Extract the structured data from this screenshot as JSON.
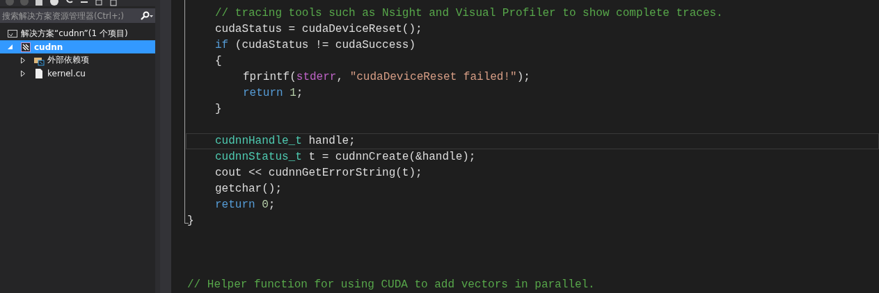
{
  "solution_explorer": {
    "search": {
      "placeholder": "搜索解决方案资源管理器(Ctrl+;)"
    },
    "tree": [
      {
        "label": "解决方案“cudnn”(1 个项目)",
        "kind": "solution",
        "selected": false,
        "children": [
          {
            "label": "cudnn",
            "kind": "project",
            "selected": true,
            "expanded": true,
            "children": [
              {
                "label": "外部依赖项",
                "kind": "references",
                "selected": false,
                "expanded": false
              },
              {
                "label": "kernel.cu",
                "kind": "file",
                "selected": false,
                "expanded": false
              }
            ]
          }
        ]
      }
    ]
  },
  "editor": {
    "lines": [
      {
        "children": [
          {
            "current": false,
            "tokens": [
              {
                "kind": "comment",
                "text": "// tracing tools such as Nsight and Visual Profiler to show complete traces."
              }
            ]
          },
          {
            "current": false,
            "tokens": [
              {
                "kind": "plain",
                "text": "cudaStatus = cudaDeviceReset();"
              }
            ]
          },
          {
            "current": false,
            "tokens": [
              {
                "kind": "keyword",
                "text": "if"
              },
              {
                "kind": "plain",
                "text": " (cudaStatus != cudaSuccess)"
              }
            ]
          },
          {
            "current": false,
            "tokens": [
              {
                "kind": "plain",
                "text": "{"
              }
            ]
          },
          {
            "children": [
              {
                "current": false,
                "tokens": [
                  {
                    "kind": "plain",
                    "text": "fprintf("
                  },
                  {
                    "kind": "macro",
                    "text": "stderr"
                  },
                  {
                    "kind": "plain",
                    "text": ", "
                  },
                  {
                    "kind": "string",
                    "text": "\"cudaDeviceReset failed!\""
                  },
                  {
                    "kind": "plain",
                    "text": ");"
                  }
                ]
              },
              {
                "current": false,
                "tokens": [
                  {
                    "kind": "keyword",
                    "text": "return"
                  },
                  {
                    "kind": "number",
                    "text": " 1"
                  },
                  {
                    "kind": "plain",
                    "text": ";"
                  }
                ]
              }
            ]
          },
          {
            "current": false,
            "tokens": [
              {
                "kind": "plain",
                "text": "}"
              }
            ]
          },
          {
            "current": false
          },
          {
            "current": true,
            "tokens": [
              {
                "kind": "type",
                "text": "cudnnHandle_t"
              },
              {
                "kind": "plain",
                "text": " handle;"
              }
            ]
          },
          {
            "current": false,
            "tokens": [
              {
                "kind": "type",
                "text": "cudnnStatus_t"
              },
              {
                "kind": "plain",
                "text": " t = cudnnCreate(&handle);"
              }
            ]
          },
          {
            "current": false,
            "tokens": [
              {
                "kind": "plain",
                "text": "cout << cudnnGetErrorString(t);"
              }
            ]
          },
          {
            "current": false,
            "tokens": [
              {
                "kind": "plain",
                "text": "getchar();"
              }
            ]
          },
          {
            "current": false,
            "tokens": [
              {
                "kind": "keyword",
                "text": "return"
              },
              {
                "kind": "number",
                "text": " 0"
              },
              {
                "kind": "plain",
                "text": ";"
              }
            ]
          }
        ]
      },
      {
        "current": false,
        "tokens": [
          {
            "kind": "plain",
            "text": "}"
          }
        ]
      },
      {
        "current": false
      },
      {
        "current": false
      },
      {
        "current": false
      },
      {
        "current": false,
        "tokens": [
          {
            "kind": "comment",
            "text": "// Helper function for using CUDA to add vectors in parallel."
          }
        ]
      }
    ]
  }
}
